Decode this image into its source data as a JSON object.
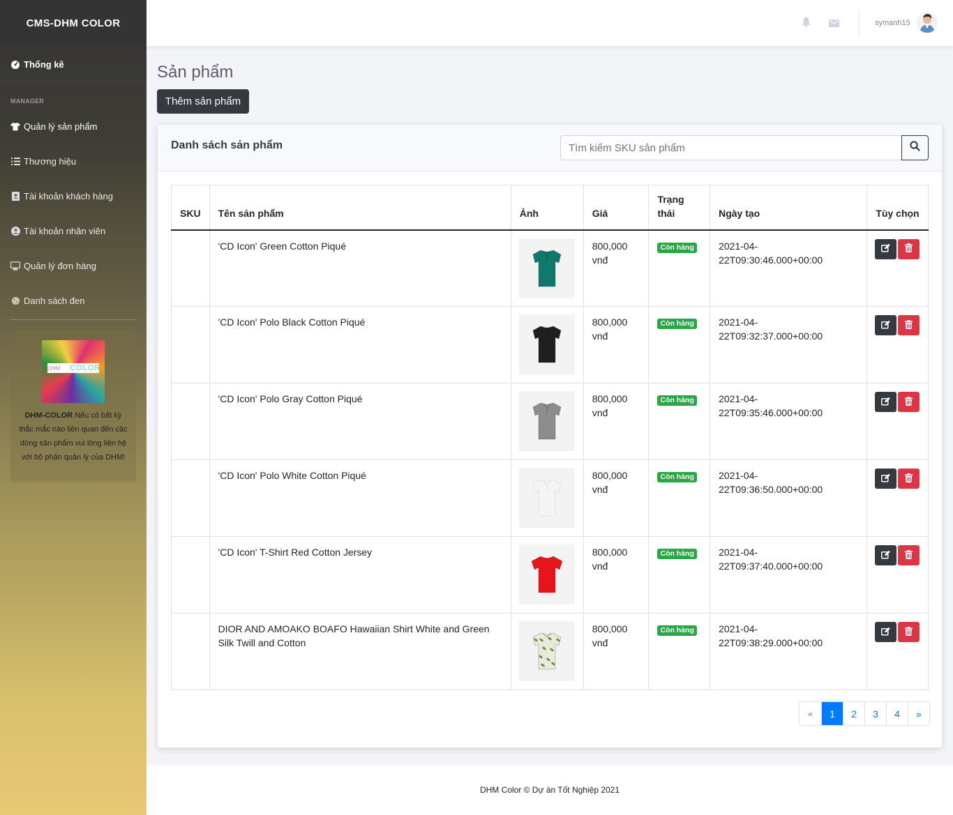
{
  "brand": "CMS-DHM COLOR",
  "sidebar": {
    "dashboard": "Thống kê",
    "section": "MANAGER",
    "items": [
      {
        "label": "Quản lý sản phẩm",
        "icon": "tshirt-icon"
      },
      {
        "label": "Thương hiệu",
        "icon": "list-icon"
      },
      {
        "label": "Tài khoản khách hàng",
        "icon": "address-book-icon"
      },
      {
        "label": "Tài khoản nhân viên",
        "icon": "user-circle-icon"
      },
      {
        "label": "Quản lý đơn hàng",
        "icon": "desktop-icon"
      },
      {
        "label": "Danh sách đen",
        "icon": "cookie-icon"
      }
    ],
    "promo": {
      "logo_small": "DHM",
      "logo_big": "COLOR",
      "brand": "DHM-COLOR",
      "text": " Nếu có bất kỳ thắc mắc nào liên quan đến các dòng sản phẩm vui lòng liên hệ với bộ phận quản lý của DHM!"
    }
  },
  "topbar": {
    "username": "symanh15"
  },
  "page": {
    "title": "Sản phẩm",
    "add_button": "Thêm sản phẩm"
  },
  "card": {
    "title": "Danh sách sản phẩm",
    "search_placeholder": "Tìm kiếm SKU sản phẩm"
  },
  "table": {
    "headers": [
      "SKU",
      "Tên sản phẩm",
      "Ảnh",
      "Giá",
      "Trạng thái",
      "Ngày tạo",
      "Tùy chọn"
    ],
    "rows": [
      {
        "sku": "",
        "name": "'CD Icon' Green Cotton Piqué",
        "price": "800,000 vnđ",
        "status": "Còn hàng",
        "date": "2021-04-22T09:30:46.000+00:00",
        "shirt_color": "#0f7a6c",
        "shirt_type": "polo"
      },
      {
        "sku": "",
        "name": "'CD Icon' Polo Black Cotton Piqué",
        "price": "800,000 vnđ",
        "status": "Còn hàng",
        "date": "2021-04-22T09:32:37.000+00:00",
        "shirt_color": "#1f1f1f",
        "shirt_type": "polo"
      },
      {
        "sku": "",
        "name": "'CD Icon' Polo Gray Cotton Piqué",
        "price": "800,000 vnđ",
        "status": "Còn hàng",
        "date": "2021-04-22T09:35:46.000+00:00",
        "shirt_color": "#8d8d8d",
        "shirt_type": "polo"
      },
      {
        "sku": "",
        "name": "'CD Icon' Polo White Cotton Piqué",
        "price": "800,000 vnđ",
        "status": "Còn hàng",
        "date": "2021-04-22T09:36:50.000+00:00",
        "shirt_color": "#f4f4f4",
        "shirt_type": "polo"
      },
      {
        "sku": "",
        "name": "'CD Icon' T-Shirt Red Cotton Jersey",
        "price": "800,000 vnđ",
        "status": "Còn hàng",
        "date": "2021-04-22T09:37:40.000+00:00",
        "shirt_color": "#e8141b",
        "shirt_type": "tee"
      },
      {
        "sku": "",
        "name": "DIOR AND AMOAKO BOAFO Hawaiian Shirt White and Green Silk Twill and Cotton",
        "price": "800,000 vnđ",
        "status": "Còn hàng",
        "date": "2021-04-22T09:38:29.000+00:00",
        "shirt_color": "#e6ecd8",
        "shirt_type": "hawaiian"
      }
    ]
  },
  "pagination": {
    "prev": "«",
    "pages": [
      "1",
      "2",
      "3",
      "4"
    ],
    "active": "1",
    "next": "»"
  },
  "footer": "DHM Color © Dự án Tốt Nghiệp 2021",
  "colors": {
    "dark": "#343a40",
    "success": "#28a745",
    "danger": "#dc3545",
    "primary": "#007bff"
  }
}
